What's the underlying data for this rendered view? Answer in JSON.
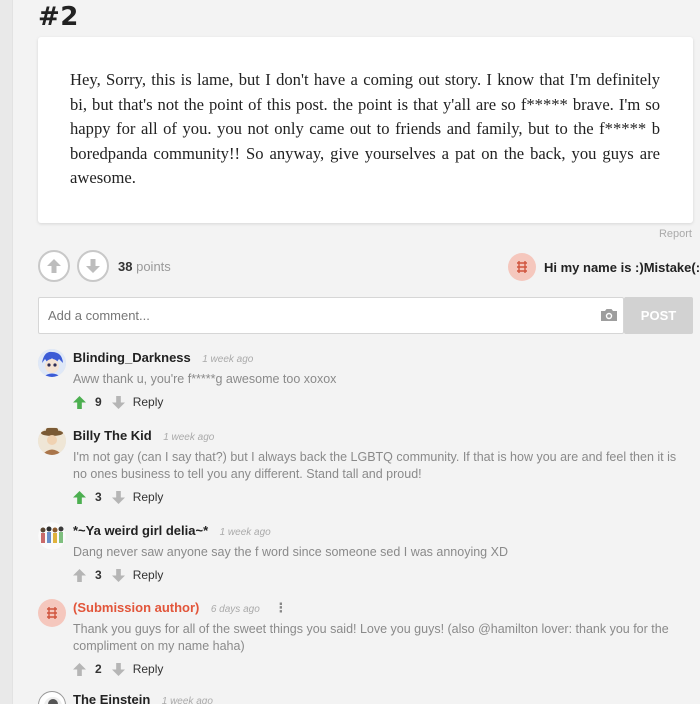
{
  "post": {
    "number": "#2",
    "body": "Hey, Sorry, this is lame, but I don't have a coming out story. I know that I'm definitely bi, but that's not the point of this post. the point is that y'all are so f***** brave. I'm so happy for all of you. you not only came out to friends and family, but to the f***** b boredpanda community!! So anyway, give yourselves a pat on the back, you guys are awesome.",
    "report_label": "Report",
    "points_value": "38",
    "points_label": "points",
    "author_name": "Hi my name is :)Mistake(:"
  },
  "comment_form": {
    "placeholder": "Add a comment...",
    "post_label": "POST"
  },
  "comments": [
    {
      "name": "Blinding_Darkness",
      "time": "1 week ago",
      "text": "Aww thank u, you're f*****g awesome too xoxox",
      "score": "9",
      "reply": "Reply"
    },
    {
      "name": "Billy The Kid",
      "time": "1 week ago",
      "text": "I'm not gay (can I say that?) but I always back the LGBTQ community. If that is how you are and feel then it is no ones business to tell you any different. Stand tall and proud!",
      "score": "3",
      "reply": "Reply"
    },
    {
      "name": "*~Ya weird girl delia~*",
      "time": "1 week ago",
      "text": "Dang never saw anyone say the f word since someone sed I was annoying XD",
      "score": "3",
      "reply": "Reply"
    },
    {
      "name": "(Submission author)",
      "time": "6 days ago",
      "menu": "⋮",
      "text": "Thank you guys for all of the sweet things you said! Love you guys! (also @hamilton lover: thank you for the compliment on my name haha)",
      "score": "2",
      "reply": "Reply"
    },
    {
      "name": "The Einstein",
      "time": "1 week ago"
    }
  ],
  "colors": {
    "upvote_active": "#4caf50",
    "author_accent": "#e2553a",
    "logo_bg": "#f5c7bd"
  },
  "icons": [
    "upvote-icon",
    "downvote-icon",
    "camera-icon",
    "site-logo-icon",
    "vertical-dots-icon"
  ]
}
